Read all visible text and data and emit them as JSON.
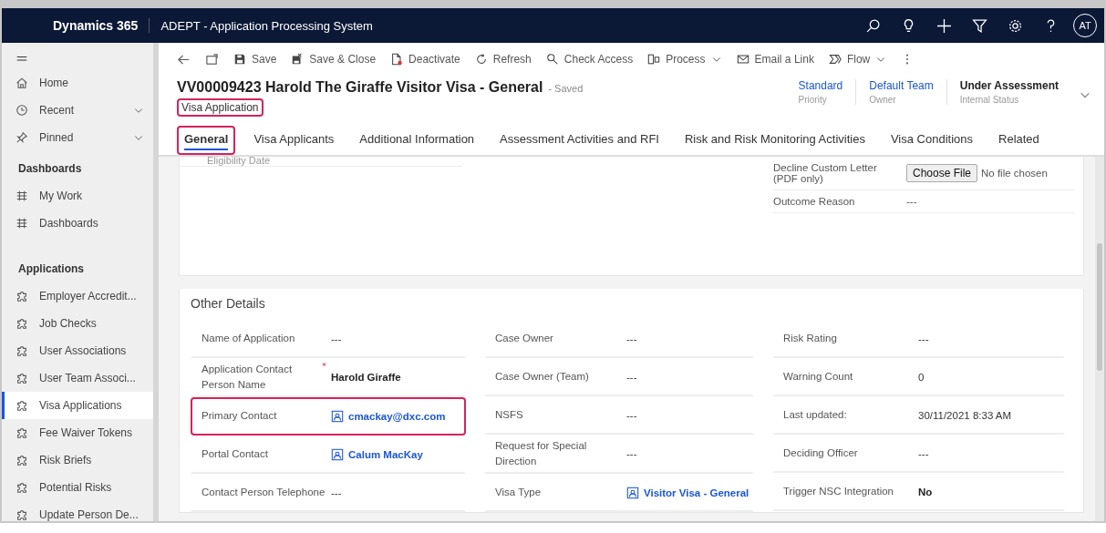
{
  "header": {
    "app": "Dynamics 365",
    "title": "ADEPT - Application Processing System",
    "avatar": "AT"
  },
  "sidebar": {
    "top": [
      {
        "label": "Home",
        "kind": "home",
        "expandable": false
      },
      {
        "label": "Recent",
        "kind": "clock",
        "expandable": true
      },
      {
        "label": "Pinned",
        "kind": "pin",
        "expandable": true
      }
    ],
    "groups": [
      {
        "title": "Dashboards",
        "items": [
          {
            "label": "My Work",
            "kind": "dashboard",
            "selected": false
          },
          {
            "label": "Dashboards",
            "kind": "dashboard",
            "selected": false
          }
        ]
      },
      {
        "title": "Applications",
        "items": [
          {
            "label": "Employer Accredit...",
            "kind": "puzzle",
            "selected": false
          },
          {
            "label": "Job Checks",
            "kind": "puzzle",
            "selected": false
          },
          {
            "label": "User Associations",
            "kind": "puzzle",
            "selected": false
          },
          {
            "label": "User Team Associ...",
            "kind": "puzzle",
            "selected": false
          },
          {
            "label": "Visa Applications",
            "kind": "puzzle",
            "selected": true
          },
          {
            "label": "Fee Waiver Tokens",
            "kind": "puzzle",
            "selected": false
          },
          {
            "label": "Risk Briefs",
            "kind": "puzzle",
            "selected": false
          },
          {
            "label": "Potential Risks",
            "kind": "puzzle",
            "selected": false
          },
          {
            "label": "Update Person De...",
            "kind": "puzzle",
            "selected": false
          }
        ]
      }
    ]
  },
  "commands": [
    {
      "label": "Save",
      "kind": "save",
      "dropdown": false
    },
    {
      "label": "Save & Close",
      "kind": "saveclose",
      "dropdown": false
    },
    {
      "label": "Deactivate",
      "kind": "deactivate",
      "dropdown": false
    },
    {
      "label": "Refresh",
      "kind": "refresh",
      "dropdown": false
    },
    {
      "label": "Check Access",
      "kind": "access",
      "dropdown": false
    },
    {
      "label": "Process",
      "kind": "process",
      "dropdown": true
    },
    {
      "label": "Email a Link",
      "kind": "email",
      "dropdown": false
    },
    {
      "label": "Flow",
      "kind": "flow",
      "dropdown": true
    }
  ],
  "record": {
    "title": "VV00009423 Harold The Giraffe Visitor Visa - General",
    "status": "- Saved",
    "entity": "Visa Application",
    "entity_annotated": true,
    "header_fields": [
      {
        "value": "Standard",
        "label": "Priority",
        "link": true
      },
      {
        "value": "Default Team",
        "label": "Owner",
        "link": true
      },
      {
        "value": "Under Assessment",
        "label": "Internal Status",
        "link": false
      }
    ]
  },
  "tabs": [
    {
      "label": "General",
      "selected": true,
      "annotated": true
    },
    {
      "label": "Visa Applicants",
      "selected": false,
      "annotated": false
    },
    {
      "label": "Additional Information",
      "selected": false,
      "annotated": false
    },
    {
      "label": "Assessment Activities and RFI",
      "selected": false,
      "annotated": false
    },
    {
      "label": "Risk and Risk Monitoring Activities",
      "selected": false,
      "annotated": false
    },
    {
      "label": "Visa Conditions",
      "selected": false,
      "annotated": false
    },
    {
      "label": "Related",
      "selected": false,
      "annotated": false
    }
  ],
  "top_section": {
    "left": [
      {
        "label": "Eligibility Date"
      }
    ],
    "right": [
      {
        "label": "Decline Custom Letter (PDF only)",
        "kind": "file",
        "button": "Choose File",
        "value": "No file chosen"
      },
      {
        "label": "Outcome Reason",
        "kind": "text",
        "value": "---"
      }
    ]
  },
  "other_details": {
    "title": "Other Details",
    "columns": [
      [
        {
          "label": "Name of Application",
          "value": "---",
          "kind": "text",
          "required": false,
          "annotated": false
        },
        {
          "label": "Application Contact Person Name",
          "value": "Harold Giraffe",
          "kind": "bold",
          "required": true,
          "annotated": false
        },
        {
          "label": "Primary Contact",
          "value": "cmackay@dxc.com",
          "kind": "link",
          "required": false,
          "annotated": true
        },
        {
          "label": "Portal Contact",
          "value": "Calum MacKay",
          "kind": "link",
          "required": false,
          "annotated": false
        },
        {
          "label": "Contact Person Telephone",
          "value": "---",
          "kind": "text",
          "required": false,
          "annotated": false
        }
      ],
      [
        {
          "label": "Case Owner",
          "value": "---",
          "kind": "text",
          "required": false,
          "annotated": false
        },
        {
          "label": "Case Owner (Team)",
          "value": "---",
          "kind": "text",
          "required": false,
          "annotated": false
        },
        {
          "label": "NSFS",
          "value": "---",
          "kind": "text",
          "required": false,
          "annotated": false
        },
        {
          "label": "Request for Special Direction",
          "value": "---",
          "kind": "text",
          "required": false,
          "annotated": false
        },
        {
          "label": "Visa Type",
          "value": "Visitor Visa - General",
          "kind": "link",
          "required": false,
          "annotated": false
        }
      ],
      [
        {
          "label": "Risk Rating",
          "value": "---",
          "kind": "text",
          "required": false,
          "annotated": false
        },
        {
          "label": "Warning Count",
          "value": "0",
          "kind": "text",
          "required": false,
          "annotated": false
        },
        {
          "label": "Last updated:",
          "value": "30/11/2021 8:33 AM",
          "kind": "text",
          "required": false,
          "annotated": false
        },
        {
          "label": "Deciding Officer",
          "value": "---",
          "kind": "text",
          "required": false,
          "annotated": false
        },
        {
          "label": "Trigger NSC Integration",
          "value": "No",
          "kind": "bold",
          "required": false,
          "annotated": false
        }
      ]
    ]
  }
}
